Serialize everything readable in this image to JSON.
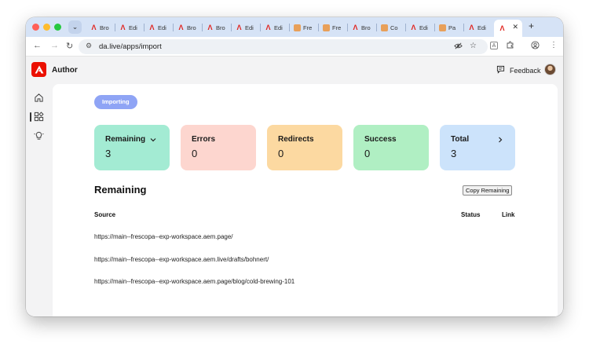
{
  "browser": {
    "tabs": [
      {
        "label": "Bro",
        "favicon": "adobe-icon"
      },
      {
        "label": "Edi",
        "favicon": "adobe-icon"
      },
      {
        "label": "Edi",
        "favicon": "adobe-icon"
      },
      {
        "label": "Bro",
        "favicon": "adobe-icon"
      },
      {
        "label": "Bro",
        "favicon": "adobe-icon"
      },
      {
        "label": "Edi",
        "favicon": "adobe-icon"
      },
      {
        "label": "Edi",
        "favicon": "adobe-icon"
      },
      {
        "label": "Fre",
        "favicon": "frescopa-icon"
      },
      {
        "label": "Fre",
        "favicon": "frescopa-icon"
      },
      {
        "label": "Bro",
        "favicon": "adobe-icon"
      },
      {
        "label": "Co",
        "favicon": "frescopa-icon"
      },
      {
        "label": "Edi",
        "favicon": "adobe-icon"
      },
      {
        "label": "Pa",
        "favicon": "frescopa-icon"
      },
      {
        "label": "Edi",
        "favicon": "adobe-icon"
      },
      {
        "label": "",
        "favicon": "adobe-icon",
        "active": true
      }
    ],
    "url": "da.live/apps/import"
  },
  "app": {
    "title": "Author",
    "feedback_label": "Feedback"
  },
  "status_badge": "Importing",
  "cards": {
    "remaining": {
      "label": "Remaining",
      "value": "3"
    },
    "errors": {
      "label": "Errors",
      "value": "0"
    },
    "redirects": {
      "label": "Redirects",
      "value": "0"
    },
    "success": {
      "label": "Success",
      "value": "0"
    },
    "total": {
      "label": "Total",
      "value": "3"
    }
  },
  "section": {
    "title": "Remaining",
    "copy_button": "Copy Remaining",
    "columns": {
      "source": "Source",
      "status": "Status",
      "link": "Link"
    },
    "rows": [
      "https://main--frescopa--exp-workspace.aem.page/",
      "https://main--frescopa--exp-workspace.aem.live/drafts/bohnert/",
      "https://main--frescopa--exp-workspace.aem.page/blog/cold-brewing-101"
    ]
  },
  "colors": {
    "accent": "#eb1000",
    "badge": "#8fa4f5",
    "remaining": "#a3ebd3",
    "errors": "#fdd6cf",
    "redirects": "#fcd9a1",
    "success": "#b0efc3",
    "total": "#cce3fb"
  }
}
